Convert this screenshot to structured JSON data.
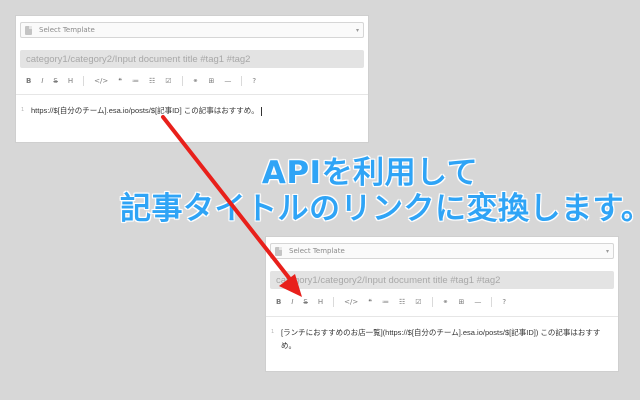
{
  "before": {
    "template_select": {
      "label": "Select Template",
      "icon": "document-icon"
    },
    "title_input": {
      "placeholder": "category1/category2/Input document title #tag1 #tag2"
    },
    "toolbar": [
      {
        "name": "bold-button",
        "label": "B"
      },
      {
        "name": "italic-button",
        "label": "I"
      },
      {
        "name": "strikethrough-button",
        "label": "S"
      },
      {
        "name": "heading-button",
        "label": "H"
      },
      {
        "name": "code-button",
        "label": "</>"
      },
      {
        "name": "quote-button",
        "label": "❝"
      },
      {
        "name": "bullet-list-button",
        "label": "≔"
      },
      {
        "name": "numbered-list-button",
        "label": "☷"
      },
      {
        "name": "checkbox-button",
        "label": "☑"
      },
      {
        "name": "link-button",
        "label": "🔗"
      },
      {
        "name": "table-button",
        "label": "⊞"
      },
      {
        "name": "hr-button",
        "label": "—"
      },
      {
        "name": "help-button",
        "label": "?"
      }
    ],
    "editor": {
      "line_number": "1",
      "text": "https://$[自分のチーム].esa.io/posts/$[記事ID] この記事はおすすめ。"
    }
  },
  "headline": {
    "line1": "APIを利用して",
    "line2": "記事タイトルのリンクに変換します。",
    "color": "#2fa4f6"
  },
  "after": {
    "template_select": {
      "label": "Select Template",
      "icon": "document-icon"
    },
    "title_input": {
      "placeholder": "category1/category2/Input document title #tag1 #tag2"
    },
    "editor": {
      "line_number": "1",
      "text": "[ランチにおすすめのお店一覧](https://$[自分のチーム].esa.io/posts/$[記事ID]) この記事はおすすめ。"
    }
  },
  "arrow_color": "#e8201b"
}
